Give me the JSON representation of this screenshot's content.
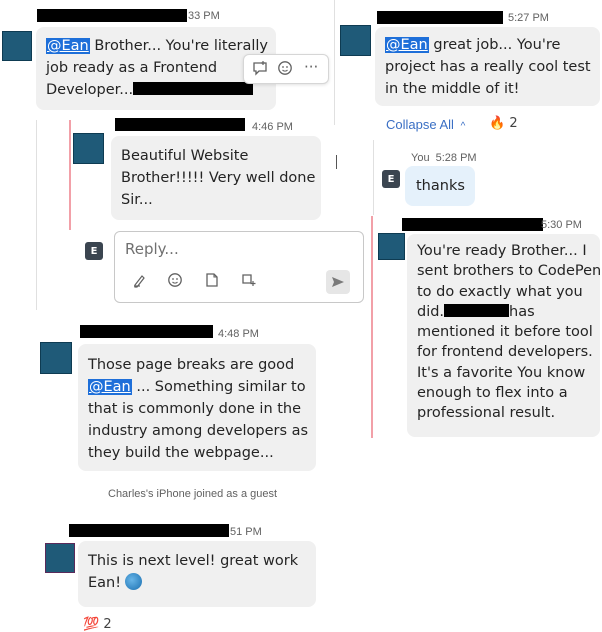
{
  "left_column": {
    "msg1": {
      "time": "33 PM",
      "lines": [
        {
          "mention": "@Ean",
          "text": " Brother... You're literally"
        },
        {
          "text": "job ready as a Frontend"
        },
        {
          "text": "Developer..."
        }
      ]
    },
    "hover_actions": {
      "reply_icon": "reply-icon",
      "emoji_icon": "emoji-icon",
      "more_label": "···"
    },
    "msg2": {
      "time": "4:46 PM",
      "lines": [
        "Beautiful Website",
        "Brother!!!!! Very well done",
        "Sir..."
      ]
    },
    "reply": {
      "avatar_letter": "E",
      "placeholder": "Reply..."
    },
    "msg3": {
      "time": "4:48 PM",
      "lines": [
        {
          "text": "Those page breaks are good"
        },
        {
          "mention": "@Ean",
          "text": " ... Something similar to"
        },
        {
          "text": "that is commonly done in the"
        },
        {
          "text": "industry among developers as"
        },
        {
          "text": "they build the webpage..."
        }
      ]
    },
    "system_message": "Charles's iPhone joined as a guest",
    "msg4": {
      "time": "51 PM",
      "lines": [
        "This is next level! great work",
        "Ean!"
      ]
    },
    "reaction": {
      "emoji": "💯",
      "count": "2"
    }
  },
  "right_column": {
    "msg1": {
      "time": "5:27 PM",
      "lines": [
        {
          "mention": "@Ean",
          "text": " great job... You're"
        },
        {
          "text": "project has a really cool test"
        },
        {
          "text": "in the middle of it!"
        }
      ]
    },
    "collapse_label": "Collapse All",
    "reaction": {
      "emoji": "🔥",
      "count": "2"
    },
    "you_msg": {
      "avatar_letter": "E",
      "sender": "You",
      "time": "5:28 PM",
      "text": "thanks"
    },
    "msg2": {
      "time": "5:30 PM",
      "lines": [
        "You're ready Brother... I",
        "sent brothers to CodePen",
        "to do exactly what you",
        "did.",
        "has",
        "mentioned it before tool",
        "for frontend developers.",
        "It's a favorite  You know",
        "enough to flex into a",
        "professional result."
      ]
    }
  },
  "colors": {
    "bubble": "#f0f0f0",
    "mention": "#1e6fd9",
    "thread_accent": "#f2a0a8",
    "you_bubble": "#e5f1fb",
    "avatar": "#1f5a78"
  }
}
